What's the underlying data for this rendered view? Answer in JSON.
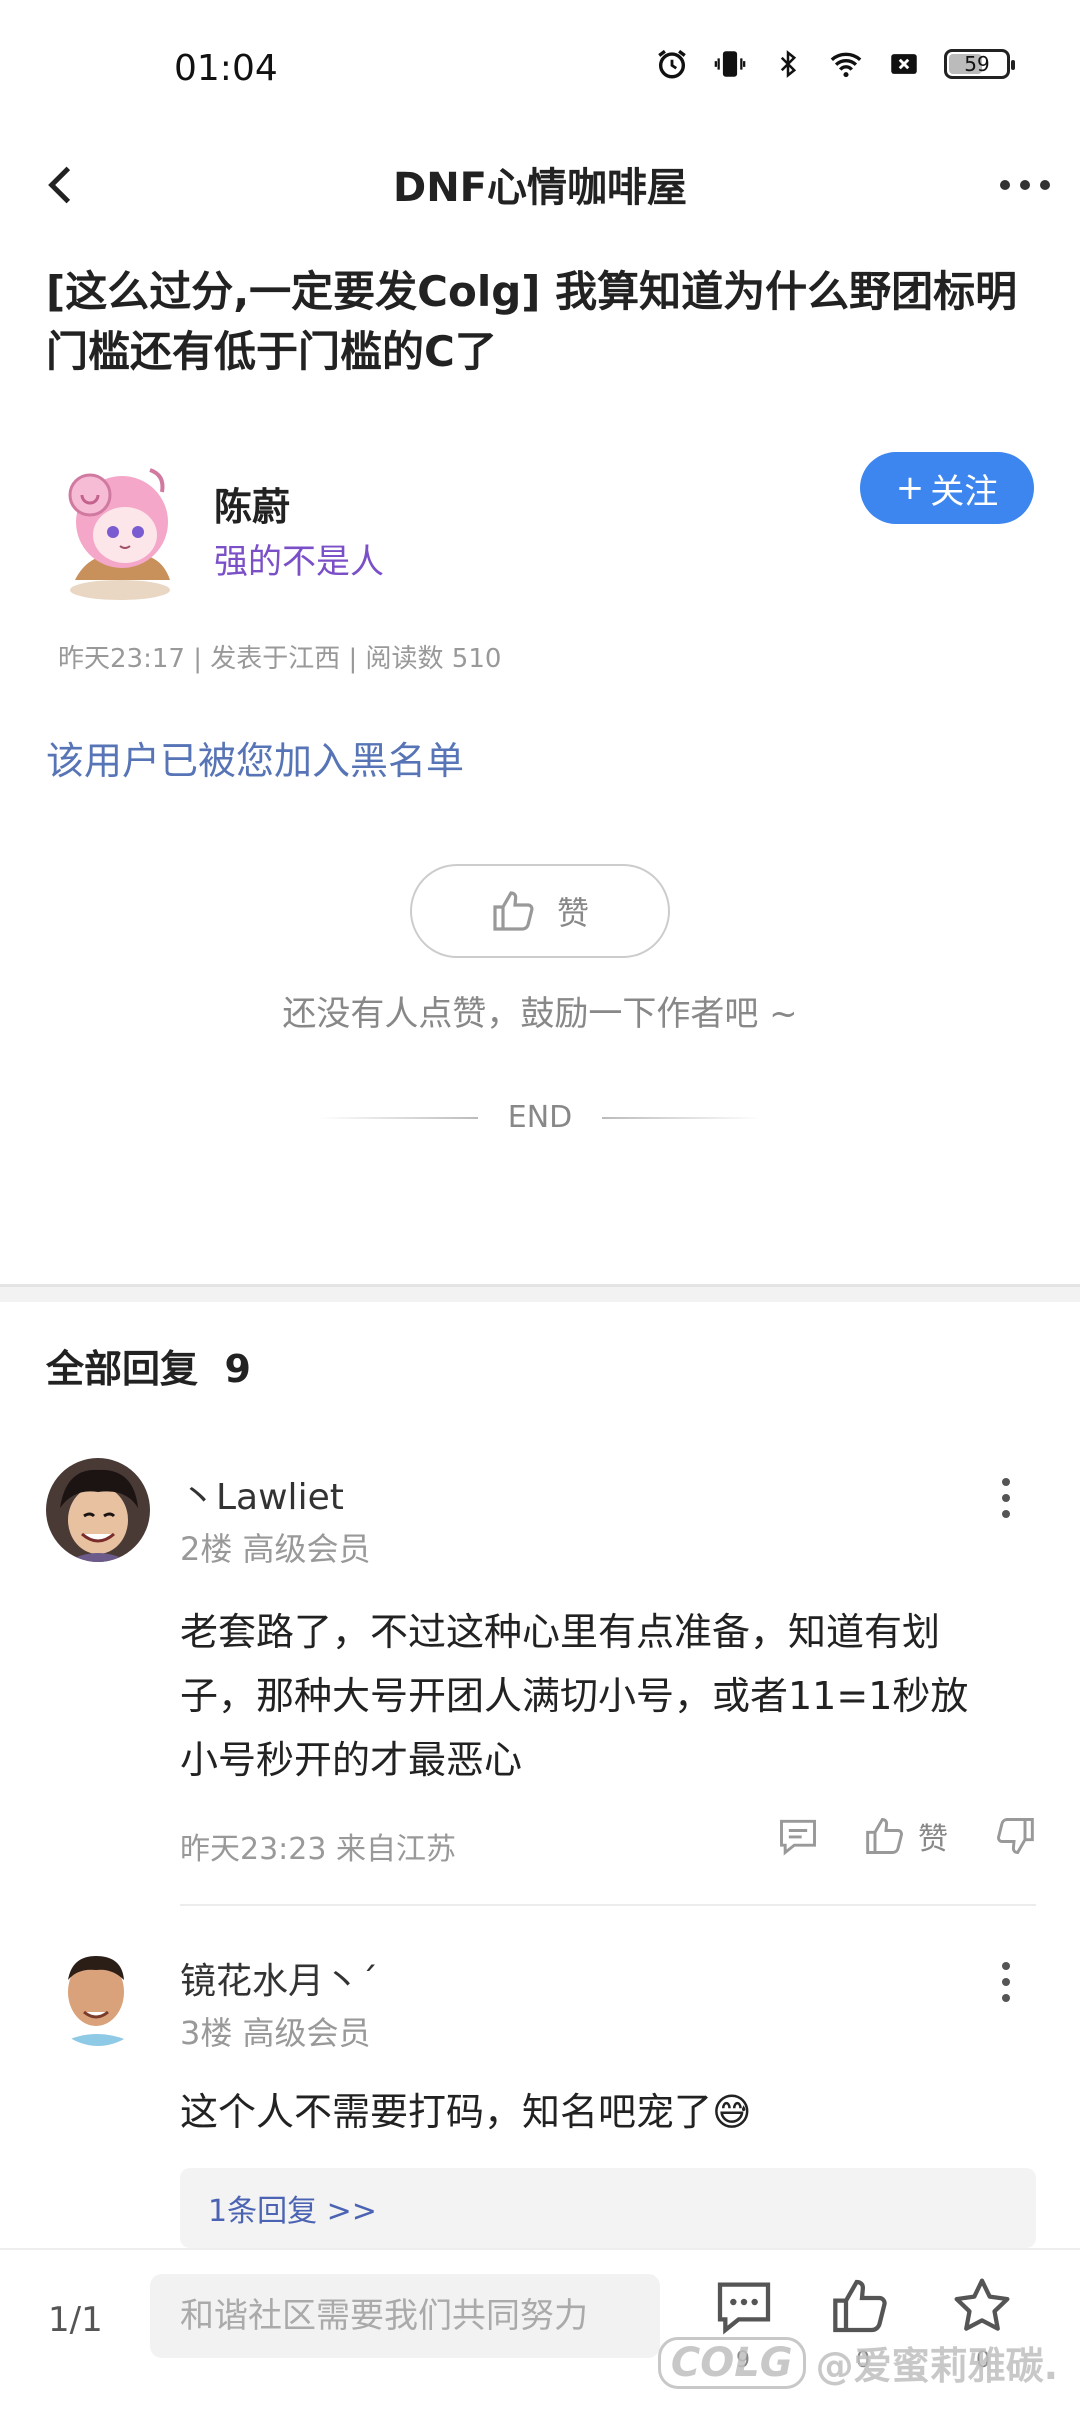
{
  "status_bar": {
    "time": "01:04",
    "battery": "59",
    "battery_level": 0.59
  },
  "nav": {
    "title": "DNF心情咖啡屋"
  },
  "post": {
    "title": "[这么过分,一定要发Colg] 我算知道为什么野团标明门槛还有低于门槛的C了",
    "author": {
      "name": "陈蔚",
      "signature": "强的不是人"
    },
    "follow_label": "关注",
    "follow_plus": "+",
    "meta": "昨天23:17 | 发表于江西 | 阅读数 510",
    "blocked_notice": "该用户已被您加入黑名单",
    "like_label": "赞",
    "like_hint": "还没有人点赞，鼓励一下作者吧 ~",
    "end_label": "END"
  },
  "replies": {
    "header": "全部回复",
    "count": "9",
    "items": [
      {
        "name": "丶Lawliet",
        "floor": "2楼 高级会员",
        "text": "老套路了，不过这种心里有点准备，知道有划子，那种大号开团人满切小号，或者11=1秒放小号秒开的才最恶心",
        "time": "昨天23:23 来自江苏",
        "like_label": "赞"
      },
      {
        "name": "镜花水月丶ˊ",
        "floor": "3楼 高级会员",
        "text": "这个人不需要打码，知名吧宠了😅",
        "subreply": "1条回复 >>"
      }
    ]
  },
  "bottom_bar": {
    "page": "1/1",
    "input_placeholder": "和谐社区需要我们共同努力",
    "comment_count": "9",
    "like_count": "0",
    "fav_count": "0"
  },
  "watermark": {
    "logo": "COLG",
    "text": "@爱蜜莉雅碳."
  },
  "colors": {
    "accent": "#3d86f0",
    "link": "#5774b6",
    "signature": "#7a4fc7"
  }
}
